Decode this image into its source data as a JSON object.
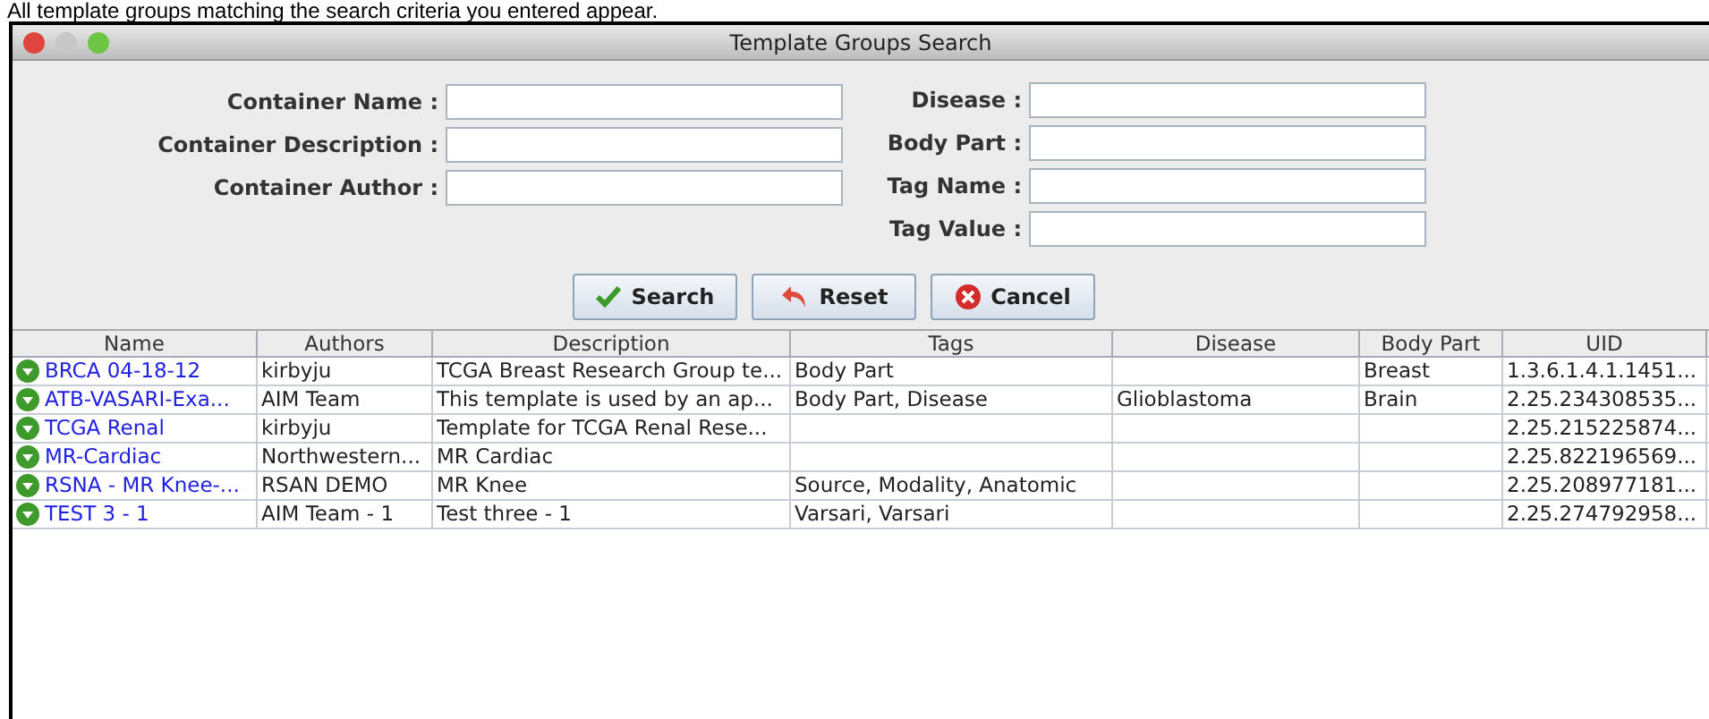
{
  "caption": "All template groups matching the search criteria you entered appear.",
  "window": {
    "title": "Template Groups Search"
  },
  "left_fields": [
    {
      "label": "Container Name :"
    },
    {
      "label": "Container Description :"
    },
    {
      "label": "Container Author :"
    }
  ],
  "right_fields": [
    {
      "label": "Disease :"
    },
    {
      "label": "Body Part :"
    },
    {
      "label": "Tag Name :"
    },
    {
      "label": "Tag Value :"
    }
  ],
  "buttons": [
    {
      "label": "Search",
      "kind": "search"
    },
    {
      "label": "Reset",
      "kind": "reset"
    },
    {
      "label": "Cancel",
      "kind": "cancel"
    }
  ],
  "table": {
    "columns": [
      "Name",
      "Authors",
      "Description",
      "Tags",
      "Disease",
      "Body Part",
      "UID"
    ],
    "rows": [
      [
        "BRCA 04-18-12",
        "kirbyju",
        "TCGA Breast Research Group te...",
        "Body Part",
        null,
        "Breast",
        "1.3.6.1.4.1.1451..."
      ],
      [
        "ATB-VASARI-Exa...",
        "AIM Team",
        "This template is used by an ap...",
        "Body Part, Disease",
        "Glioblastoma",
        "Brain",
        "2.25.234308535..."
      ],
      [
        "TCGA Renal",
        "kirbyju",
        "Template for TCGA Renal Rese...",
        null,
        null,
        null,
        "2.25.215225874..."
      ],
      [
        "MR-Cardiac",
        "Northwestern...",
        "MR Cardiac",
        null,
        null,
        null,
        "2.25.822196569..."
      ],
      [
        "RSNA - MR Knee-...",
        "RSAN DEMO",
        "MR Knee",
        "Source, Modality, Anatomic",
        null,
        null,
        "2.25.208977181..."
      ],
      [
        "TEST 3 - 1",
        "AIM Team - 1",
        "Test three - 1",
        "Varsari, Varsari",
        null,
        null,
        "2.25.274792958..."
      ]
    ]
  }
}
